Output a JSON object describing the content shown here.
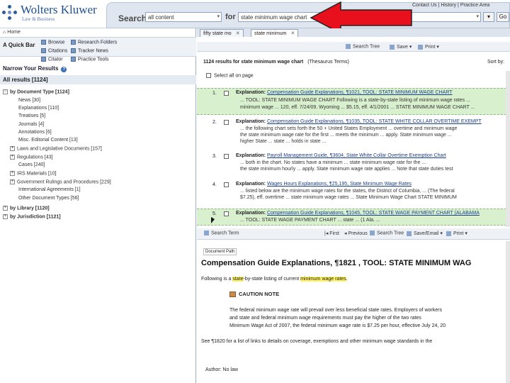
{
  "header": {
    "brand_name": "Wolters Kluwer",
    "brand_sub": "Law & Business",
    "search_label": "Search",
    "search_scope": "all content",
    "for_label": "for",
    "search_query": "state minimum wage chart",
    "go_label": "Go",
    "top_links": "Contact Us | History | Practice Area",
    "arrow_color": "#e8101c"
  },
  "left": {
    "home": "Home",
    "quick_bar": "A Quick Bar",
    "quick_items": [
      "Browse",
      "Citations",
      "Citator",
      "Research Folders",
      "Tracker News",
      "Practice Tools"
    ],
    "narrow": "Narrow Your Results",
    "all_results": "All results [1124]",
    "tree": [
      {
        "label": "by Document Type [1124]",
        "exp": "−",
        "bold": true
      },
      {
        "label": "News [30]",
        "exp": "",
        "bold": false
      },
      {
        "label": "Explanations [110]",
        "exp": "",
        "bold": false
      },
      {
        "label": "Treatises [5]",
        "exp": "",
        "bold": false
      },
      {
        "label": "Journals [4]",
        "exp": "",
        "bold": false
      },
      {
        "label": "Annotations [6]",
        "exp": "",
        "bold": false
      },
      {
        "label": "Misc. Editorial Content [13]",
        "exp": "",
        "bold": false
      },
      {
        "label": "Laws and Legislative Documents [157]",
        "exp": "+",
        "bold": false
      },
      {
        "label": "Regulations [43]",
        "exp": "+",
        "bold": false
      },
      {
        "label": "Cases [240]",
        "exp": "",
        "bold": false
      },
      {
        "label": "IRS Materials [10]",
        "exp": "+",
        "bold": false
      },
      {
        "label": "Government Rulings and Procedures [229]",
        "exp": "+",
        "bold": false
      },
      {
        "label": "International Agreements [1]",
        "exp": "",
        "bold": false
      },
      {
        "label": "Other Document Types [56]",
        "exp": "",
        "bold": false
      },
      {
        "label": "by Library [1120]",
        "exp": "+",
        "bold": true
      },
      {
        "label": "by Jurisdiction [1121]",
        "exp": "+",
        "bold": true
      }
    ]
  },
  "tabs": [
    "fifty state mo",
    "state minimum"
  ],
  "toolbar1": {
    "search_tree": "Search Tree",
    "save": "Save",
    "print": "Print"
  },
  "results": {
    "count_text": "1124 results for state minimum wage chart",
    "thesaurus": "(Thesaurus Terms)",
    "sort": "Sort by:",
    "select_page": "Select all on page",
    "items": [
      {
        "n": "1.",
        "type": "Explanation:",
        "title": "Compensation Guide Explanations, ¶1021, TOOL: STATE MINIMUM WAGE CHART",
        "l1": "... TOOL: STATE MINIMUM WAGE CHART Following is a state-by-state listing of minimum wage rates ...",
        "l2": "minimum wage ... 120, eff. 7/24/09. Wyoming ... $5.15, eff. 4/1/2001 ... STATE MINIMUM WAGE CHART ..."
      },
      {
        "n": "2.",
        "type": "Explanation:",
        "title": "Compensation Guide Explanations, ¶1035, TOOL: STATE WHITE COLLAR OVERTIME EXEMPT",
        "l1": "... the following chart sets forth the 50 + United States Employment ... overtime and minimum wage",
        "l2": "the state minimum wage rate for the first ... meets the minimum ... apply. State minimum wage ...",
        "l3": "higher State ... state ... holds in state ..."
      },
      {
        "n": "3.",
        "type": "Explanation:",
        "title": "Payroll Management Guide, ¶3604, State White Collar Overtime Exemption Chart",
        "l1": "... both in the chart. No states have a minimum ... state minimum wage rate for the ...",
        "l2": "the state minimum hourly ... apply. State minimum wage rate applies ... Note that state duties test"
      },
      {
        "n": "4.",
        "type": "Explanation:",
        "title": "Wages Hours Explanations, ¶25,195, State Minimum Wage Rates",
        "l1": "... listed below are the minimum wage rates for the states, the District of Columbia, ... (The federal",
        "l2": "$7.25), eff. overtime ... state minimum wage rates ... State Minimum Wage Chart STATE MINIMUM"
      },
      {
        "n": "5.",
        "type": "Explanation:",
        "title": "Compensation Guide Explanations, ¶1045, TOOL: STATE WAGE PAYMENT CHART (ALABAMA",
        "l1": "... TOOL: STATE WAGE PAYMENT CHART ... state ... (1 Ala. ..."
      }
    ]
  },
  "toolbar2": {
    "search_term": "Search Term",
    "first": "First",
    "previous": "Previous",
    "search_tree": "Search Tree",
    "save_email": "Save/Email",
    "print": "Print"
  },
  "doc": {
    "path": "Document Path",
    "title": "Compensation Guide Explanations, ¶1821 , TOOL: STATE MINIMUM WAG",
    "intro_pre": "Following is a ",
    "intro_hl1": "state",
    "intro_mid": "-by-state listing of current ",
    "intro_hl2": "minimum wage rates",
    "intro_end": ".",
    "caution": "CAUTION NOTE",
    "c1": "The federal minimum wage rate will prevail over less beneficial state rates. Employers of workers",
    "c2": "and state and federal minimum wage requirements must pay the higher of the two rates",
    "c3": "Minimum Wage Act of 2007, the federal minimum wage rate is $7.25 per hour, effective July 24, 20",
    "see": "See ¶1820 for a list of links to details on coverage, exemptions and other minimum wage standards in the",
    "author": "Author:     No law"
  }
}
